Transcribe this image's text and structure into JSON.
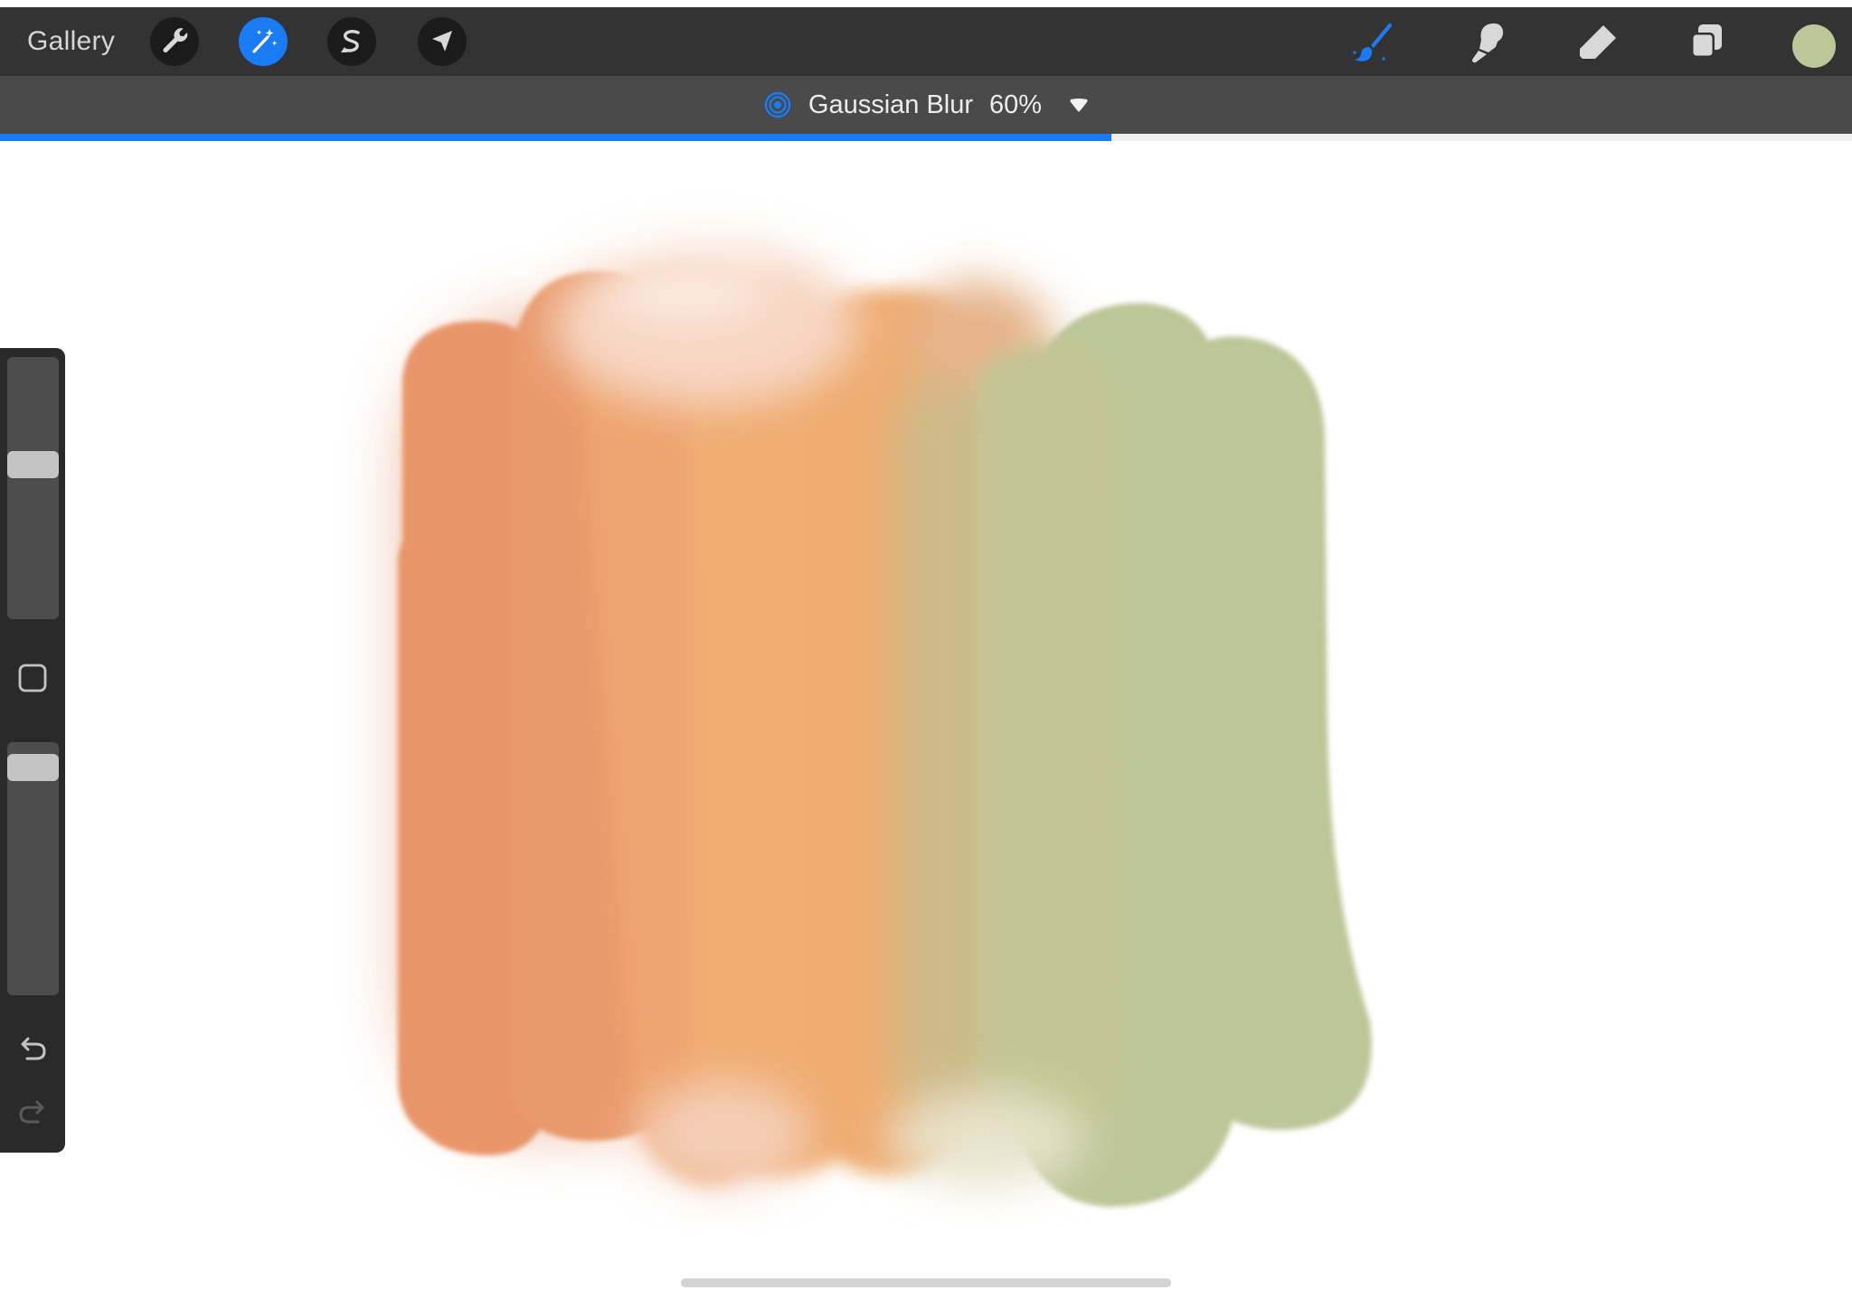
{
  "toolbar": {
    "gallery_label": "Gallery",
    "left_tools": [
      {
        "name": "actions",
        "icon": "wrench-icon",
        "active": false
      },
      {
        "name": "adjustments",
        "icon": "magic-wand-icon",
        "active": true
      },
      {
        "name": "selection",
        "icon": "selection-s-icon",
        "active": false
      },
      {
        "name": "transform",
        "icon": "transform-arrow-icon",
        "active": false
      }
    ],
    "right_tools": [
      {
        "name": "brush",
        "icon": "brush-icon",
        "active": true
      },
      {
        "name": "smudge",
        "icon": "smudge-icon",
        "active": false
      },
      {
        "name": "eraser",
        "icon": "eraser-icon",
        "active": false
      },
      {
        "name": "layers",
        "icon": "layers-icon",
        "active": false
      }
    ],
    "current_color": "#bdc698",
    "accent_color": "#1a7cf5"
  },
  "adjustment": {
    "icon": "gaussian-blur-icon",
    "name": "Gaussian Blur",
    "value": "60%",
    "progress": 0.6,
    "dropdown_icon": "triangle-down-icon"
  },
  "sidebar": {
    "brush_size_level": 0.6,
    "opacity_level": 0.95,
    "modify_icon": "square-outline-icon",
    "undo_icon": "undo-icon",
    "redo_icon": "redo-icon",
    "redo_enabled": false
  },
  "canvas": {
    "paint_colors": [
      "#e8946a",
      "#efae72",
      "#bdc698"
    ]
  }
}
